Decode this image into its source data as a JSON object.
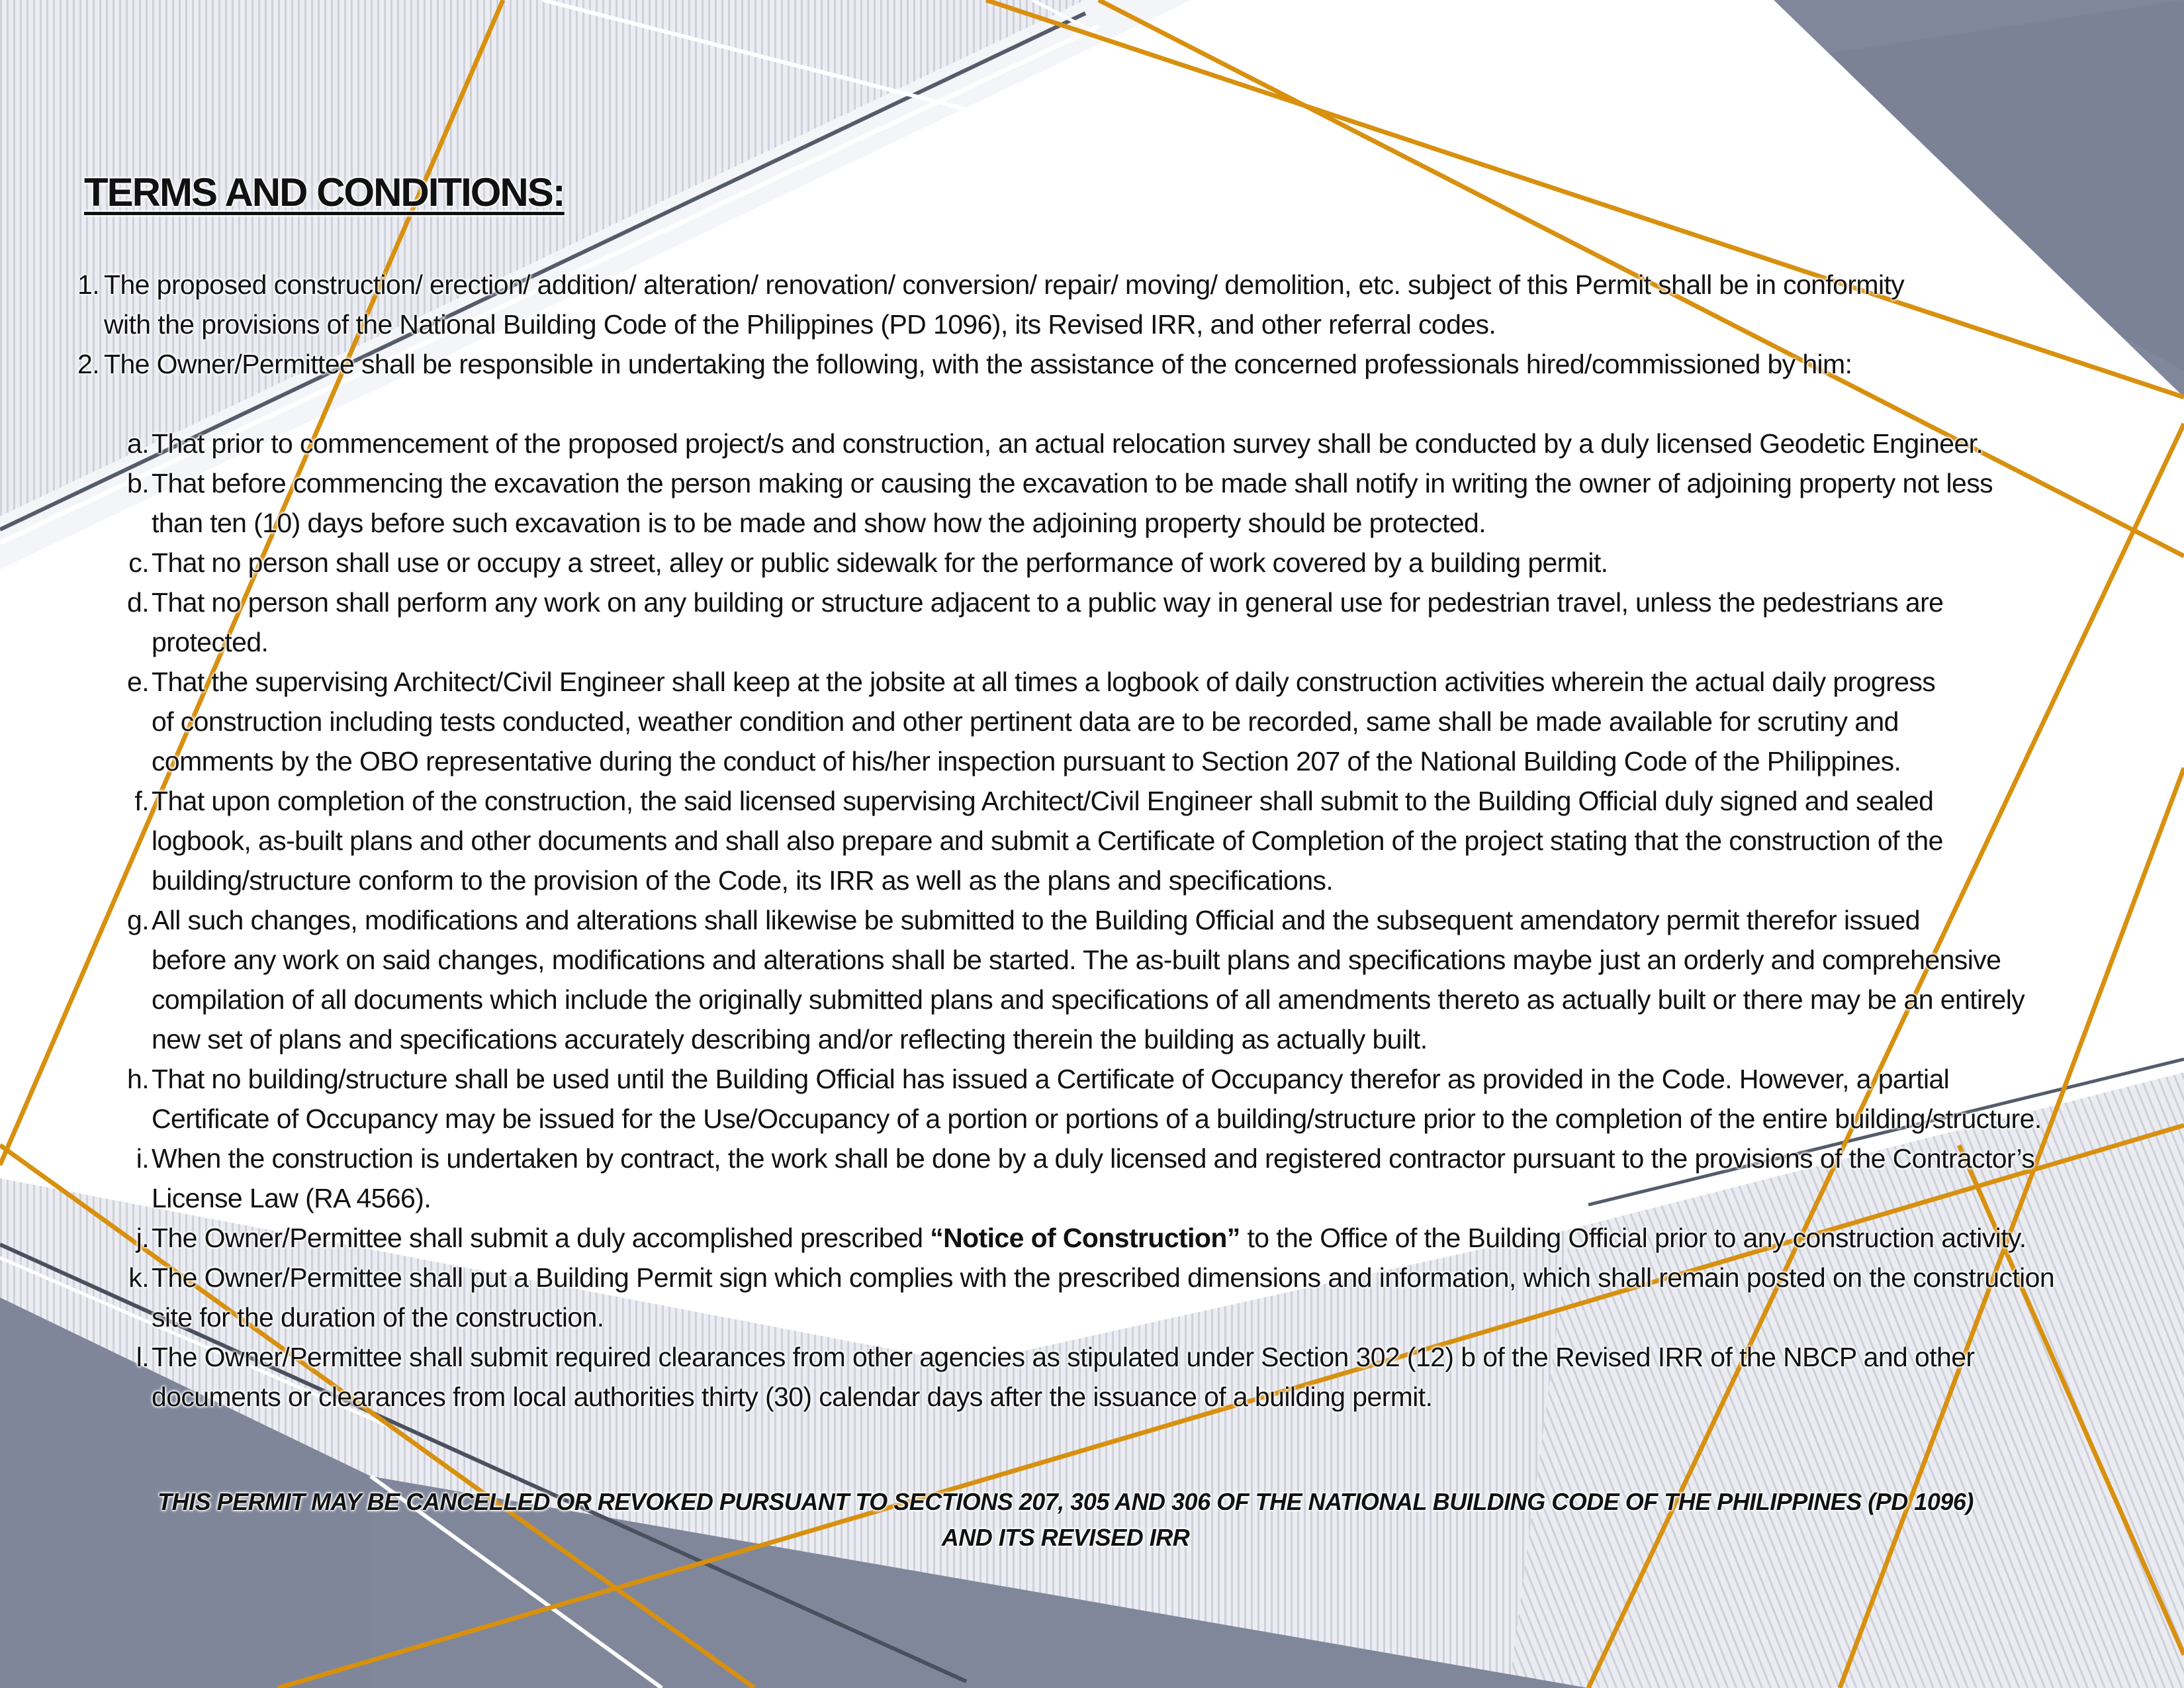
{
  "heading": "TERMS AND CONDITIONS:",
  "numbered": [
    {
      "num": "1.",
      "lines": [
        "The proposed construction/ erection/ addition/ alteration/ renovation/ conversion/ repair/ moving/ demolition, etc. subject of this Permit shall be in conformity",
        "with the provisions of the National Building Code of the Philippines (PD 1096), its Revised IRR, and other referral codes."
      ]
    },
    {
      "num": "2.",
      "lines": [
        "The Owner/Permittee shall be responsible in undertaking the following, with the assistance of the concerned professionals hired/commissioned by him:"
      ]
    }
  ],
  "subitems": [
    {
      "letter": "a.",
      "lines": [
        "That prior to commencement of the proposed project/s and construction, an actual relocation survey shall be conducted by a duly licensed Geodetic Engineer."
      ]
    },
    {
      "letter": "b.",
      "lines": [
        "That before commencing the excavation the person making or causing the excavation to be made shall notify in writing the owner of adjoining property not less",
        "than ten (10) days before such excavation is to be made and show how the adjoining property should be protected."
      ]
    },
    {
      "letter": "c.",
      "lines": [
        "That no person shall use or occupy a street, alley or public sidewalk for the performance of work covered by a building permit."
      ]
    },
    {
      "letter": "d.",
      "lines": [
        "That no person shall perform any work on any building or structure adjacent to a public way in general use for pedestrian travel, unless the pedestrians are",
        "protected."
      ]
    },
    {
      "letter": "e.",
      "lines": [
        "That the supervising Architect/Civil Engineer shall keep at the jobsite at all times a logbook of daily construction activities wherein the actual daily progress",
        "of construction including tests conducted, weather condition and other pertinent data are to be recorded, same shall be made available for scrutiny and",
        "comments by the OBO representative during the conduct of his/her inspection pursuant to Section 207 of the National Building Code of the Philippines."
      ]
    },
    {
      "letter": "f.",
      "lines": [
        "That upon completion of the construction, the said licensed supervising Architect/Civil Engineer shall submit to the Building Official duly signed and sealed",
        "logbook, as-built plans and other documents and shall also prepare and submit a Certificate of Completion of the project stating that the construction of the",
        "building/structure conform to the provision of the Code, its IRR as well as the plans and specifications."
      ]
    },
    {
      "letter": "g.",
      "lines": [
        "All such changes, modifications and alterations shall likewise be submitted to the Building Official and the subsequent amendatory permit therefor issued",
        "before any work on said changes, modifications and alterations shall be started. The as-built plans and specifications maybe just an orderly and comprehensive",
        "compilation of all documents which include the originally submitted plans and specifications of all amendments thereto as actually built or there may be an entirely",
        "new set of plans and specifications accurately describing and/or reflecting therein the building as actually built."
      ]
    },
    {
      "letter": "h.",
      "lines": [
        "That no building/structure shall be used until the Building Official has issued a Certificate of Occupancy therefor as provided in the Code. However, a partial",
        "Certificate of Occupancy may be issued for the Use/Occupancy of a portion or portions of a building/structure prior to the completion of the entire building/structure."
      ]
    },
    {
      "letter": "i.",
      "lines": [
        "When the construction is undertaken by contract, the work shall be done by a duly licensed and registered contractor pursuant to the provisions of the Contractor’s",
        "License Law (RA 4566)."
      ]
    },
    {
      "letter": "j.",
      "parts": {
        "before": "The Owner/Permittee shall submit a duly accomplished prescribed ",
        "bold": "“Notice of Construction”",
        "after": " to the Office of the Building Official prior to any construction activity."
      }
    },
    {
      "letter": "k.",
      "lines": [
        "The Owner/Permittee shall put a Building Permit sign which complies with the prescribed dimensions and information, which shall remain posted on the construction",
        "site for the duration of the construction."
      ]
    },
    {
      "letter": "l.",
      "lines": [
        "The Owner/Permittee shall submit required clearances from other agencies as stipulated under Section 302 (12) b of the Revised IRR of the NBCP and other",
        "documents or clearances from local authorities thirty (30) calendar days after the issuance of a building permit."
      ]
    }
  ],
  "notice": {
    "line1": "THIS PERMIT MAY BE CANCELLED OR REVOKED PURSUANT TO SECTIONS 207, 305 AND 306 OF THE NATIONAL BUILDING CODE OF THE PHILIPPINES (PD 1096)",
    "line2": "AND ITS REVISED IRR"
  }
}
